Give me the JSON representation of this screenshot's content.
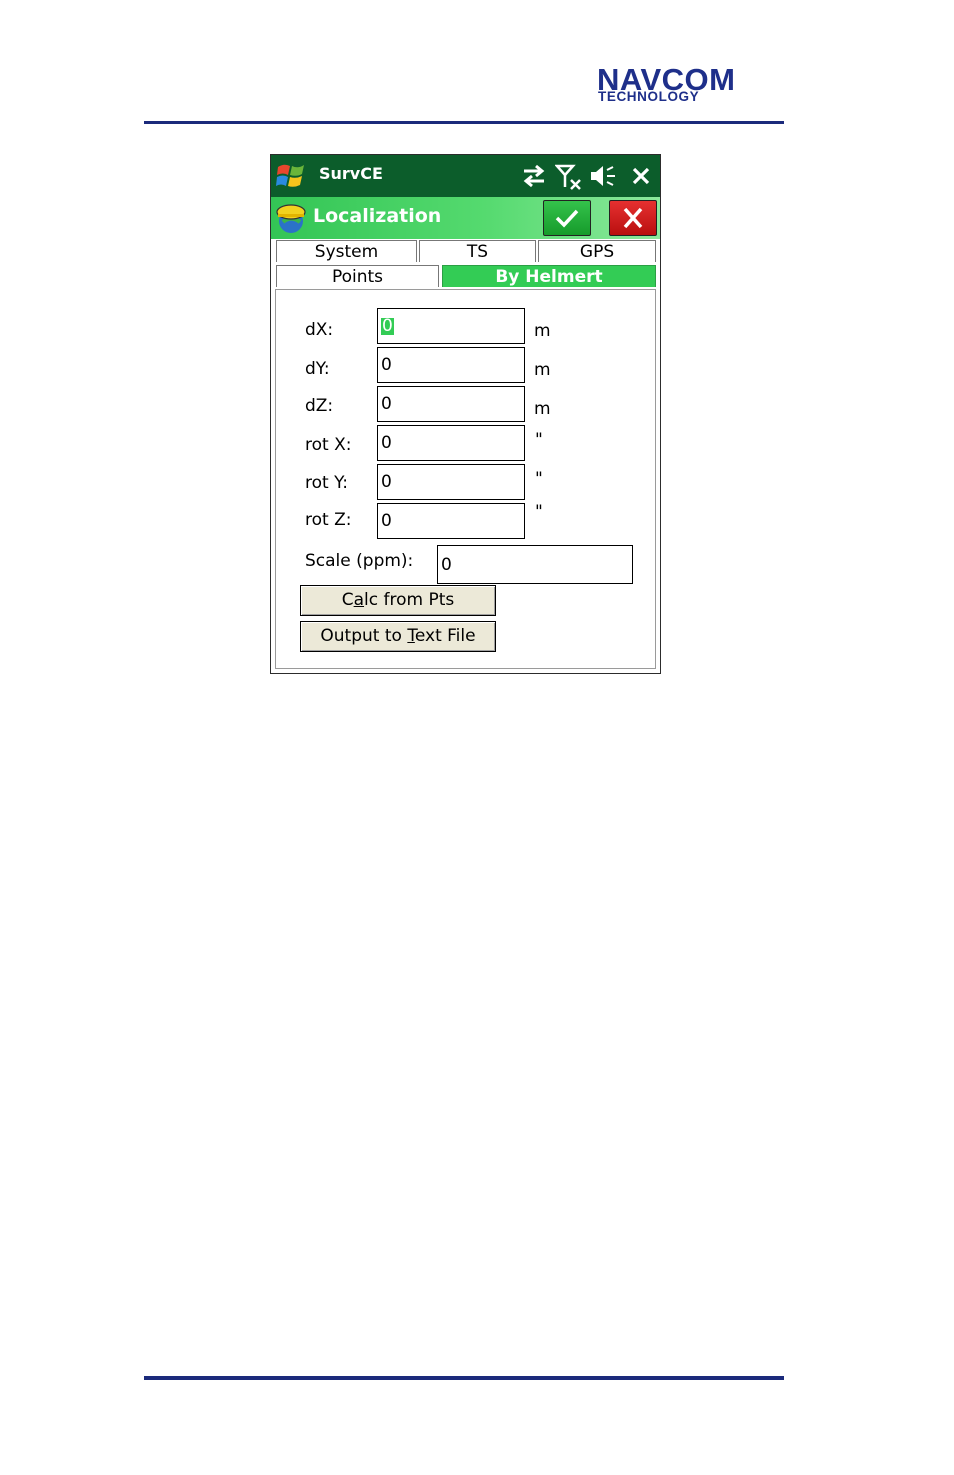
{
  "page_header": {
    "logo_line1": "NAVCOM",
    "logo_line2": "TECHNOLOGY"
  },
  "device": {
    "titlebar": {
      "app_title": "SurvCE",
      "icons": [
        "windows-start-icon",
        "sync-arrows-icon",
        "no-signal-icon",
        "speaker-muted-icon",
        "close-icon"
      ]
    },
    "header": {
      "title": "Localization",
      "ok_icon": "checkmark-icon",
      "cancel_icon": "x-icon"
    },
    "tabs_row1": [
      "System",
      "TS",
      "GPS"
    ],
    "tabs_row2": [
      "Points",
      "By Helmert"
    ],
    "active_tab": "By Helmert",
    "fields": [
      {
        "label": "dX:",
        "value": "0",
        "unit": "m"
      },
      {
        "label": "dY:",
        "value": "0",
        "unit": "m"
      },
      {
        "label": "dZ:",
        "value": "0",
        "unit": "m"
      },
      {
        "label": "rot X:",
        "value": "0",
        "unit": "\""
      },
      {
        "label": "rot Y:",
        "value": "0",
        "unit": "\""
      },
      {
        "label": "rot Z:",
        "value": "0",
        "unit": "\""
      }
    ],
    "scale": {
      "label": "Scale (ppm):",
      "value": "0"
    },
    "buttons": {
      "calc": {
        "pre": "C",
        "key": "a",
        "post": "lc from Pts"
      },
      "output": {
        "pre": "Output to ",
        "key": "T",
        "post": "ext File"
      }
    },
    "colors": {
      "titlebar": "#0c5d2b",
      "accent_green": "#33cc55",
      "cancel_red": "#d41f1f",
      "button_face": "#ece9d8"
    }
  }
}
